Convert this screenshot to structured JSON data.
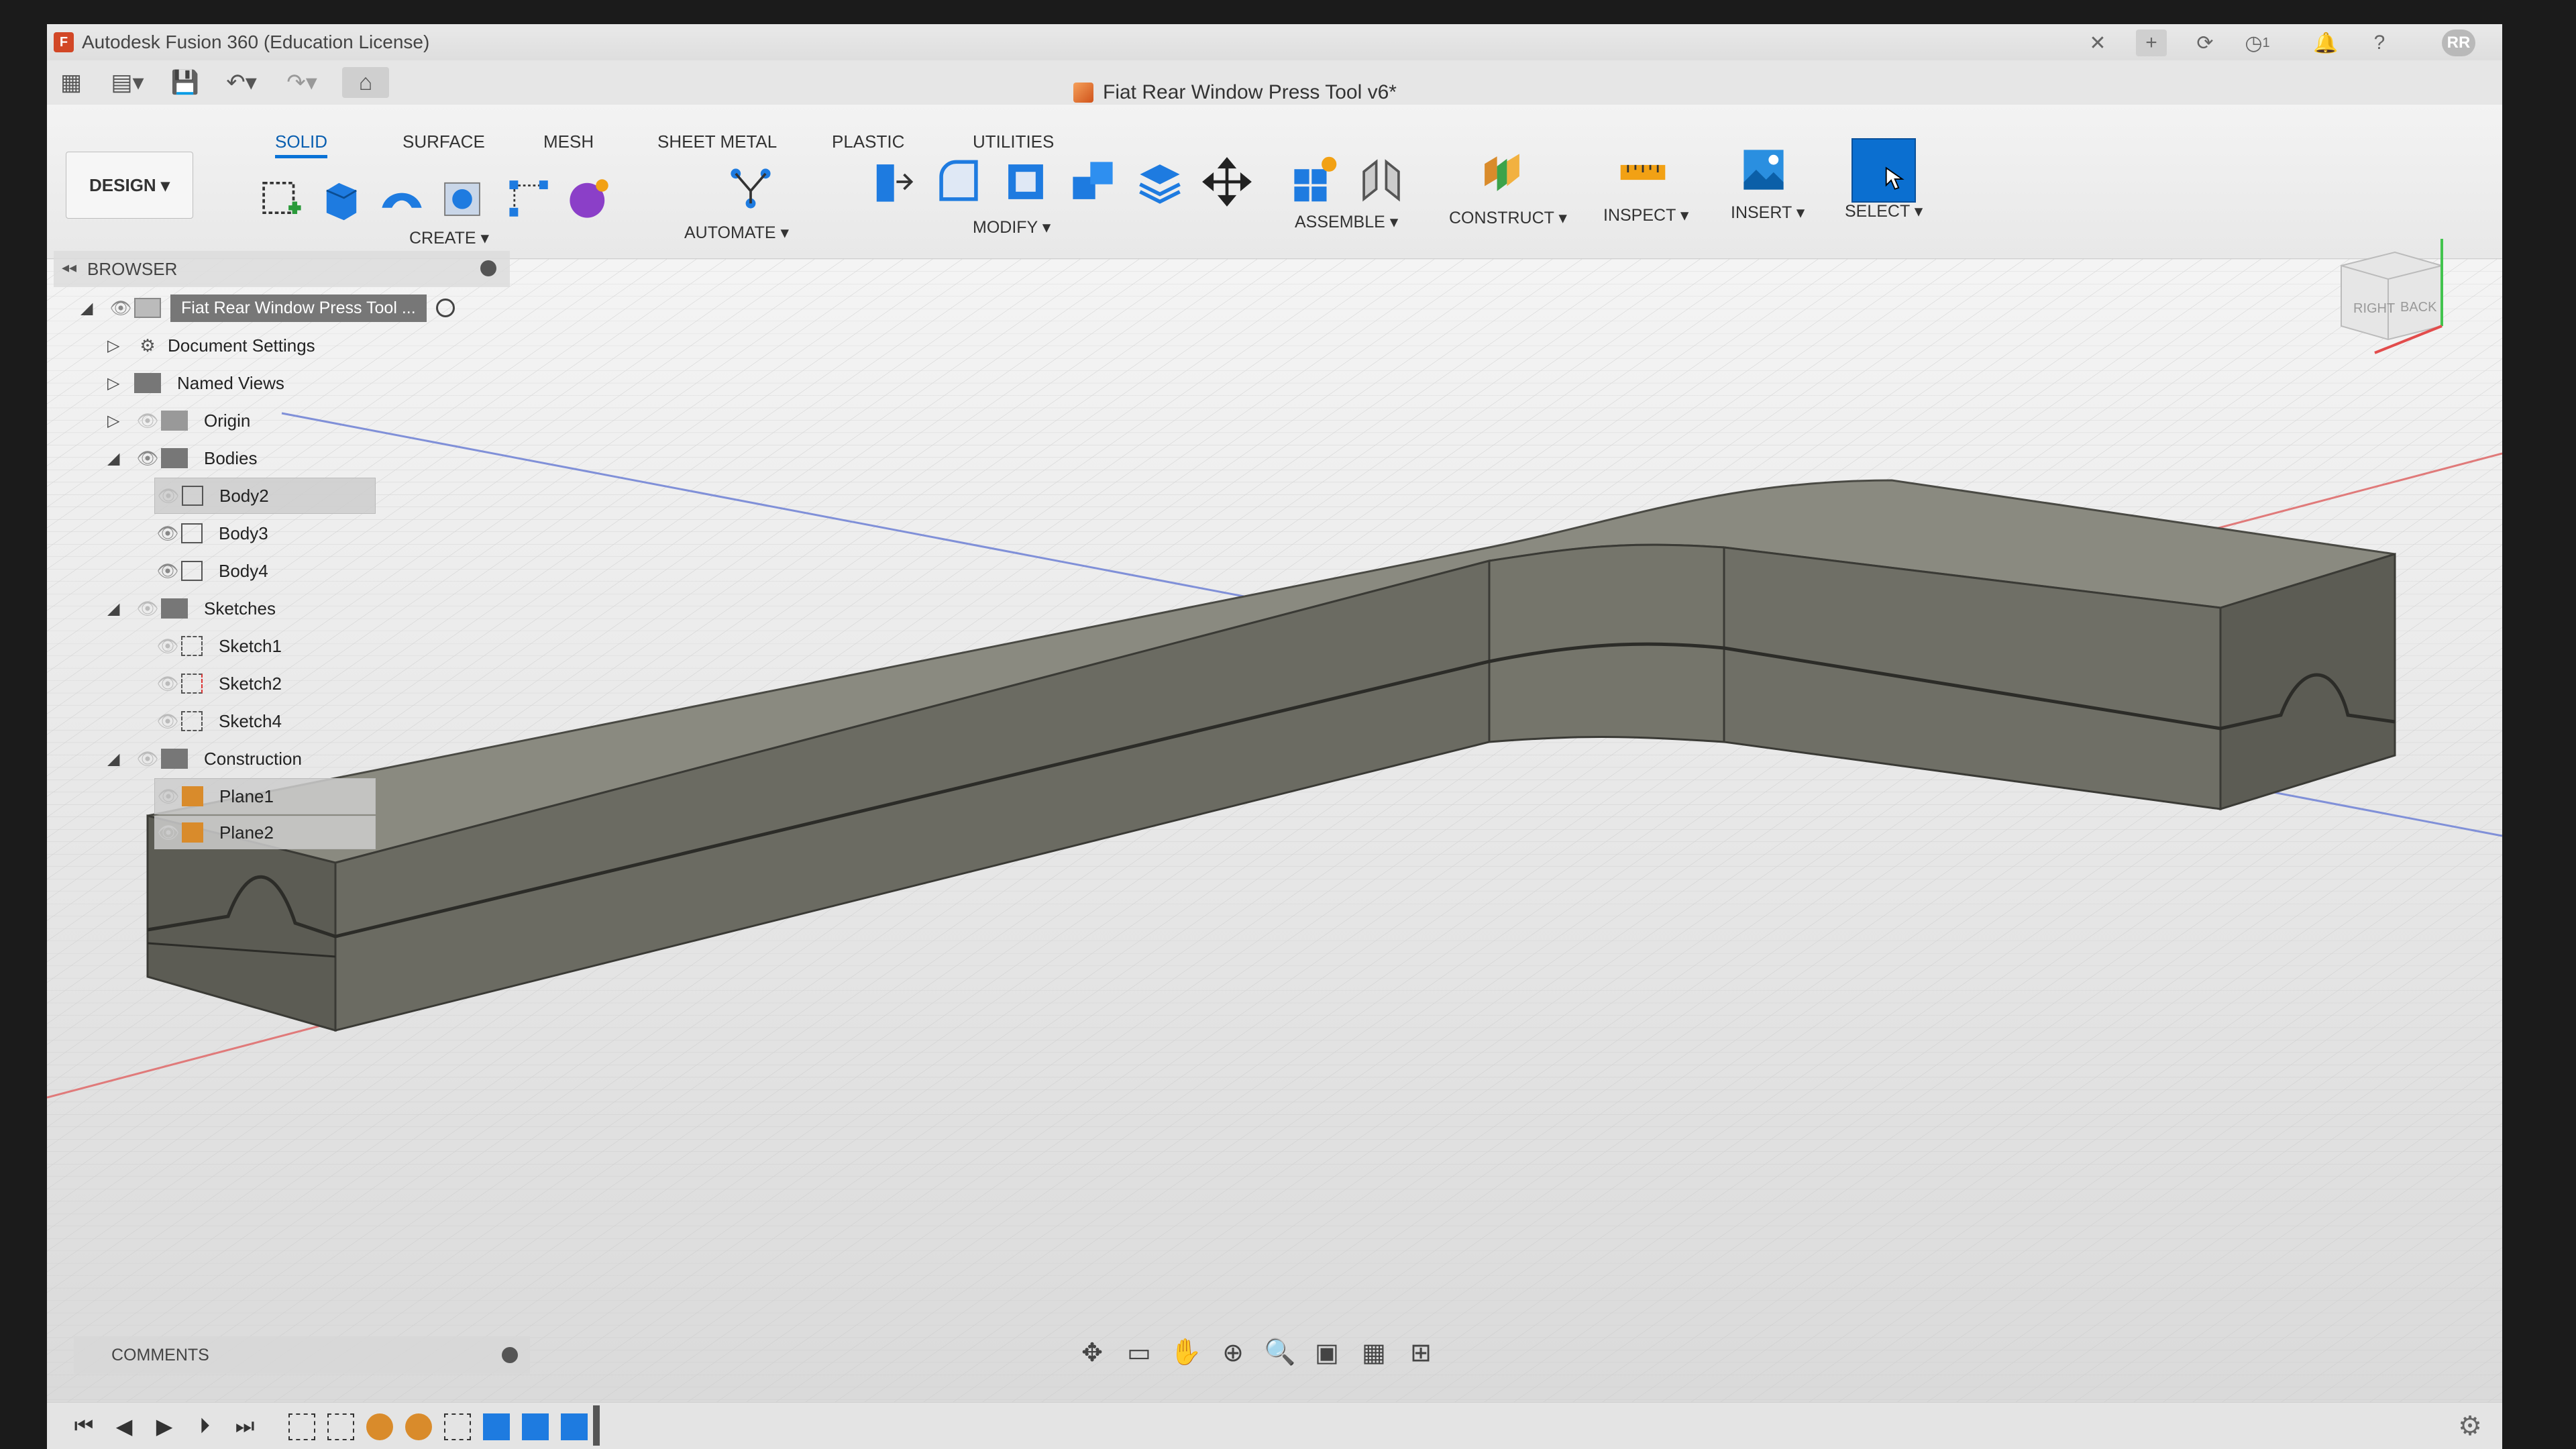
{
  "window": {
    "app_title": "Autodesk Fusion 360 (Education License)",
    "user_initials": "RR",
    "notification_count": "1",
    "document_title": "Fiat Rear Window Press Tool v6*"
  },
  "ribbon": {
    "workspace": "DESIGN ▾",
    "tabs": [
      "SOLID",
      "SURFACE",
      "MESH",
      "SHEET METAL",
      "PLASTIC",
      "UTILITIES"
    ],
    "groups": {
      "create": "CREATE ▾",
      "automate": "AUTOMATE ▾",
      "modify": "MODIFY ▾",
      "assemble": "ASSEMBLE ▾",
      "construct": "CONSTRUCT ▾",
      "inspect": "INSPECT ▾",
      "insert": "INSERT ▾",
      "select": "SELECT ▾"
    }
  },
  "browser": {
    "title": "BROWSER",
    "root": "Fiat Rear Window Press Tool ...",
    "items": {
      "document_settings": "Document Settings",
      "named_views": "Named Views",
      "origin": "Origin",
      "bodies": "Bodies",
      "body2": "Body2",
      "body3": "Body3",
      "body4": "Body4",
      "sketches": "Sketches",
      "sketch1": "Sketch1",
      "sketch2": "Sketch2",
      "sketch4": "Sketch4",
      "construction": "Construction",
      "plane1": "Plane1",
      "plane2": "Plane2"
    }
  },
  "viewcube": {
    "faces": [
      "RIGHT",
      "BACK"
    ]
  },
  "comments": {
    "title": "COMMENTS"
  }
}
